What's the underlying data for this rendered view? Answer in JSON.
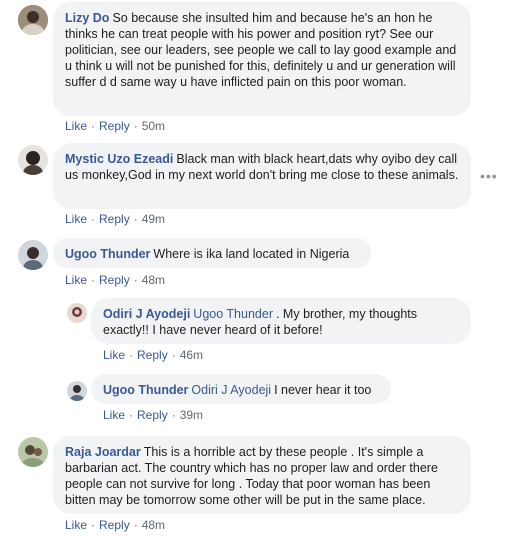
{
  "comments": [
    {
      "author": "Lizy Do",
      "text": "So because she insulted him and because he's an hon he thinks he can treat people with his power and position ryt? See our politician, see our leaders, see people we call to lay good example and u think u will not be punished for this, definitely u and ur generation will suffer d d same way u have inflicted pain on this poor woman.",
      "like": "Like",
      "reply": "Reply",
      "time": "50m"
    },
    {
      "author": "Mystic Uzo Ezeadi",
      "text": "Black man with black heart,dats why oyibo dey call us monkey,God in my next world don't bring me close to these animals.",
      "like": "Like",
      "reply": "Reply",
      "time": "49m",
      "more": "•••"
    },
    {
      "author": "Ugoo Thunder",
      "text": "Where is ika land located in Nigeria",
      "like": "Like",
      "reply": "Reply",
      "time": "48m",
      "replies": [
        {
          "author": "Odiri J Ayodeji",
          "mention": "Ugoo Thunder",
          "text": ". My brother, my thoughts exactly!! I have never heard of it before!",
          "like": "Like",
          "reply": "Reply",
          "time": "46m"
        },
        {
          "author": "Ugoo Thunder",
          "mention": "Odiri J Ayodeji",
          "text": "I never hear it too",
          "like": "Like",
          "reply": "Reply",
          "time": "39m"
        }
      ]
    },
    {
      "author": "Raja Joardar",
      "text": "This is a horrible act by these people . It's simple a barbarian act. The country which has no proper law and order there people can not survive for long . Today that poor woman has been bitten may be tomorrow some other will be put in the same place.",
      "like": "Like",
      "reply": "Reply",
      "time": "48m"
    }
  ],
  "colors": {
    "link": "#385898",
    "bubble": "#f2f3f5",
    "meta": "#606770"
  }
}
